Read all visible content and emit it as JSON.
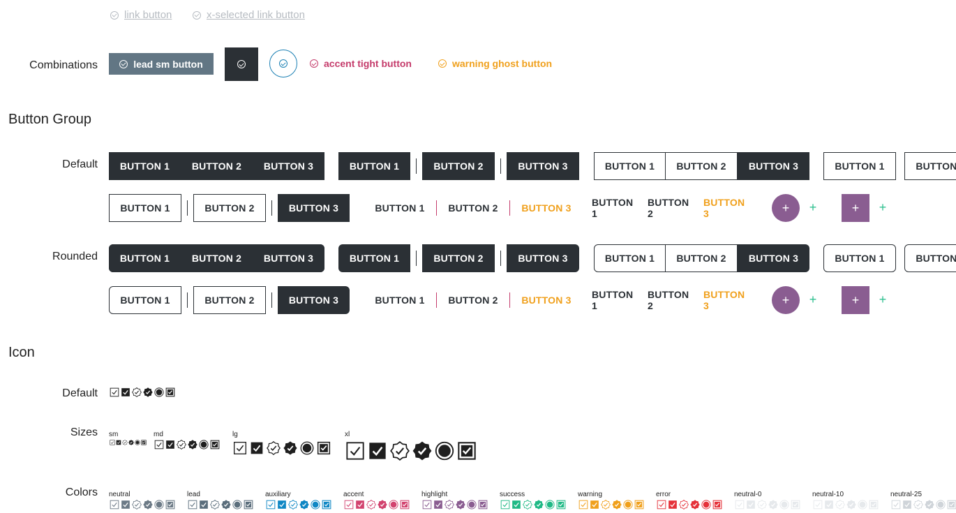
{
  "link_buttons": {
    "link": "link button",
    "x_selected": "x-selected link button"
  },
  "combinations": {
    "label": "Combinations",
    "lead_sm": "lead sm button",
    "accent_tight": "accent tight button",
    "warning_ghost": "warning ghost button"
  },
  "button_group": {
    "title": "Button Group",
    "default_label": "Default",
    "rounded_label": "Rounded",
    "b1": "BUTTON 1",
    "b2": "BUTTON 2",
    "b3": "BUTTON 3",
    "plus": "+"
  },
  "icon": {
    "title": "Icon",
    "default_label": "Default",
    "sizes_label": "Sizes",
    "colors_label": "Colors",
    "sizes": [
      "sm",
      "md",
      "lg",
      "xl"
    ],
    "colors": [
      {
        "name": "neutral",
        "hex": "#6c7a86"
      },
      {
        "name": "lead",
        "hex": "#5b6e7c"
      },
      {
        "name": "auxiliary",
        "hex": "#0f87c4"
      },
      {
        "name": "accent",
        "hex": "#d2436f"
      },
      {
        "name": "highlight",
        "hex": "#8a5d91"
      },
      {
        "name": "success",
        "hex": "#1fb985"
      },
      {
        "name": "warning",
        "hex": "#f0a01c"
      },
      {
        "name": "error",
        "hex": "#e5323a"
      },
      {
        "name": "neutral-0",
        "hex": "#ffffff"
      },
      {
        "name": "neutral-10",
        "hex": "#e6e9ec"
      },
      {
        "name": "neutral-25",
        "hex": "#cfd4d9"
      }
    ]
  },
  "colors": {
    "dark": "#2b3035",
    "lead": "#627684",
    "auxiliary": "#1a7fb3",
    "accent": "#c43a6a",
    "warning": "#f0a01c",
    "highlight": "#8a5d91",
    "success": "#2ebf8f"
  }
}
